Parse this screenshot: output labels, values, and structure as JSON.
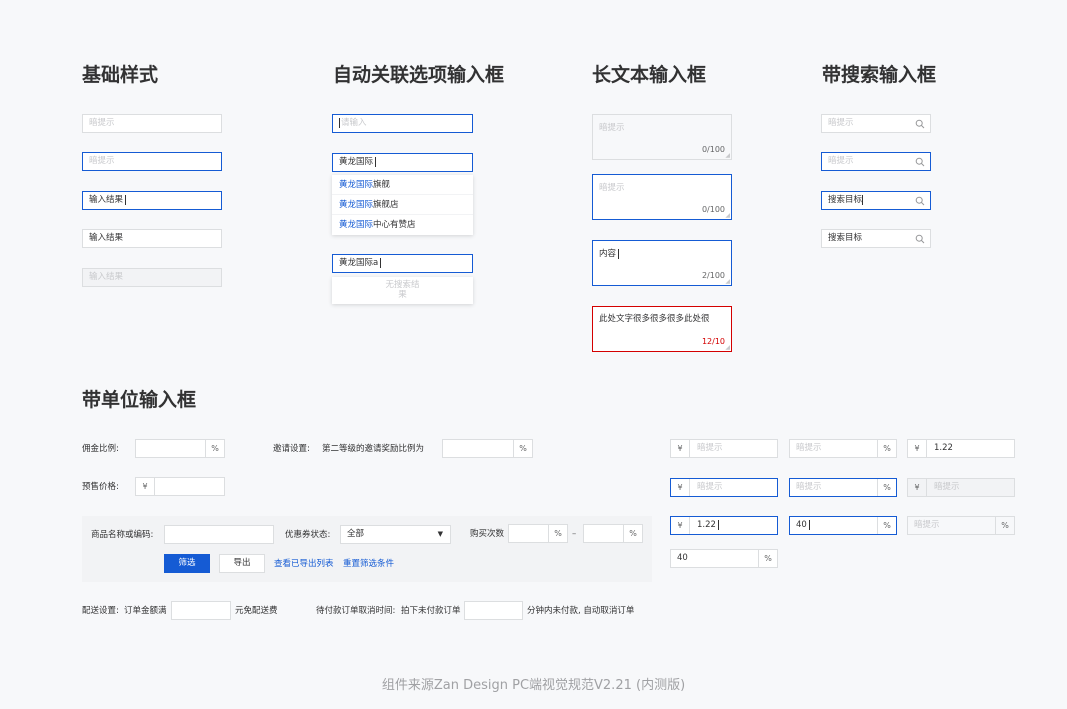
{
  "headings": {
    "basic": "基础样式",
    "auto": "自动关联选项输入框",
    "textarea": "长文本输入框",
    "search": "带搜索输入框",
    "unit": "带单位输入框"
  },
  "basic": {
    "ph1": "暗提示",
    "ph2": "暗提示",
    "val3": "输入结果",
    "val4": "输入结果",
    "val5": "输入结果"
  },
  "auto": {
    "ph1": "请输入",
    "val2": "黄龙国际",
    "options": [
      {
        "match": "黄龙国际",
        "rest": "旗舰"
      },
      {
        "match": "黄龙国际",
        "rest": "旗舰店"
      },
      {
        "match": "黄龙国际",
        "rest": "中心有赞店"
      }
    ],
    "val3": "黄龙国际a",
    "empty_line1": "无搜索结",
    "empty_line2": "果"
  },
  "textarea": {
    "ph1": "暗提示",
    "cnt1": "0/100",
    "ph2": "暗提示",
    "cnt2": "0/100",
    "val3": "内容",
    "cnt3": "2/100",
    "val4": "此处文字很多很多很多此处很",
    "cnt4": "12/10"
  },
  "search": {
    "ph1": "暗提示",
    "ph2": "暗提示",
    "val3": "搜索目标",
    "val4": "搜索目标"
  },
  "unit": {
    "commission_label": "佣金比例:",
    "percent": "%",
    "invite_label": "邀请设置:",
    "invite_text": "第二等级的邀请奖励比例为",
    "presale_label": "预售价格:",
    "yen": "¥",
    "filter": {
      "goods_label": "商品名称或编码:",
      "coupon_label": "优惠券状态:",
      "coupon_value": "全部",
      "buy_label": "购买次数",
      "dash": "–",
      "filter_btn": "筛选",
      "export_btn": "导出",
      "view_link": "查看已导出列表",
      "reset_link": "重置筛选条件"
    },
    "delivery_label": "配送设置:",
    "delivery_text1": "订单金额满",
    "delivery_text2": "元免配送费",
    "unpaid_label": "待付款订单取消时间:",
    "unpaid_text1": "拍下未付款订单",
    "unpaid_text2": "分钟内未付款, 自动取消订单",
    "ph": "暗提示",
    "v122": "1.22",
    "v40": "40"
  },
  "footer": "组件来源Zan Design PC端视觉规范V2.21 (内测版)",
  "colors": {
    "accent": "#155bd4",
    "error": "#d40000",
    "border": "#dcdee0"
  }
}
